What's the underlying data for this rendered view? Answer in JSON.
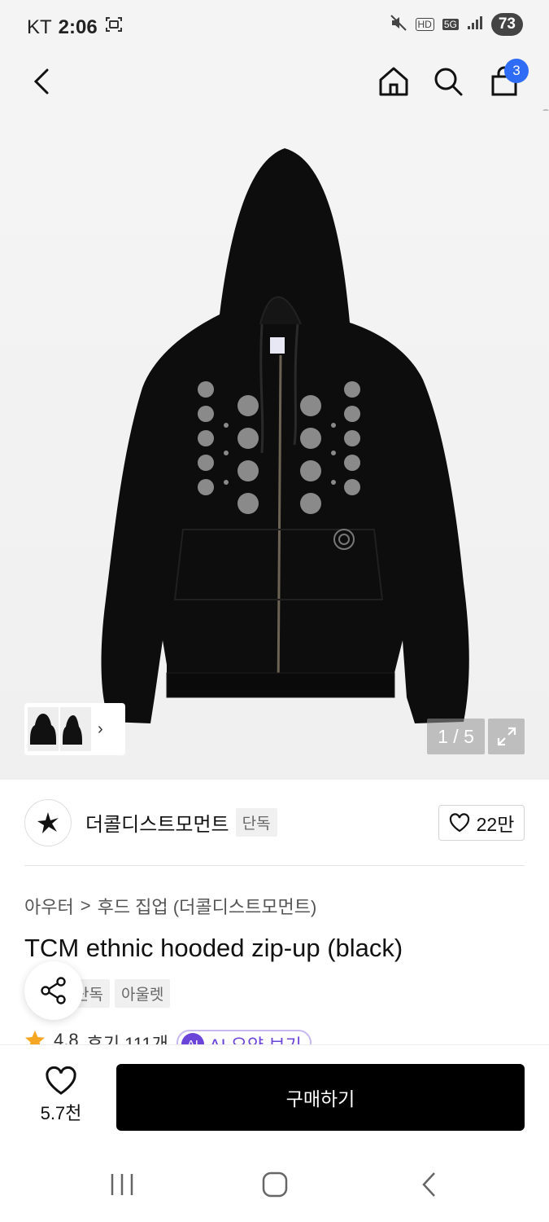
{
  "status_bar": {
    "carrier": "KT",
    "time": "2:06",
    "network": "5G",
    "hd": "HD",
    "battery": "73"
  },
  "header": {
    "cart_count": "3"
  },
  "gallery": {
    "counter": "1 / 5",
    "thumbnail_arrow": "›"
  },
  "brand": {
    "name": "더콜디스트모먼트",
    "tag": "단독",
    "like_count": "22만"
  },
  "product": {
    "breadcrumb": [
      "아우터",
      "후드 집업 (더콜디스트모먼트)"
    ],
    "breadcrumb_sep": ">",
    "title": "TCM ethnic hooded zip-up (black)",
    "tags": [
      "단독",
      "아울렛"
    ],
    "rating": "4.8",
    "reviews": "후기 111개",
    "ai_label": "AI",
    "ai_summary": "AI 요약 보기"
  },
  "action_bar": {
    "wish_count": "5.7천",
    "buy_label": "구매하기"
  },
  "colors": {
    "accent": "#2f6cf5",
    "ai_purple": "#6b45d8",
    "primary_button": "#000000"
  }
}
